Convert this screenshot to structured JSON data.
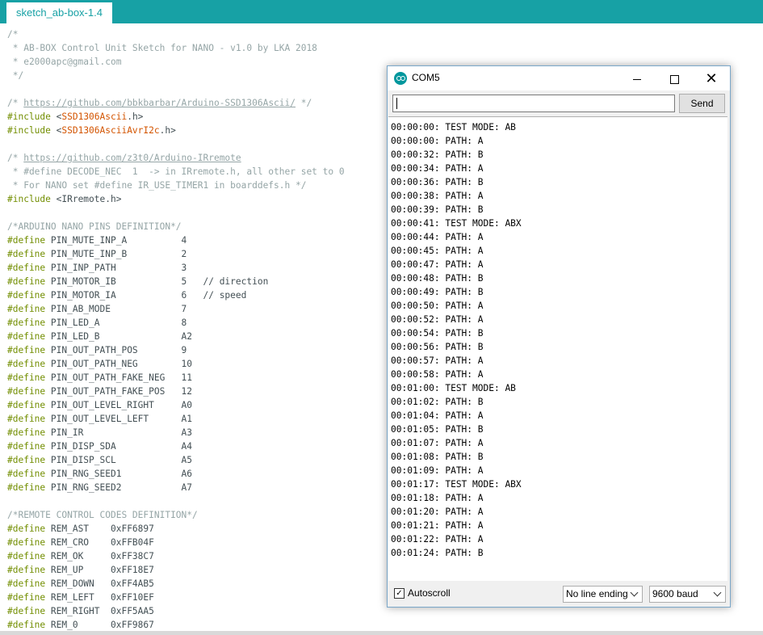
{
  "editor": {
    "tab_label": "sketch_ab-box-1.4",
    "lines": [
      [
        [
          "com",
          "/*"
        ]
      ],
      [
        [
          "com",
          " * AB-BOX Control Unit Sketch for NANO - v1.0 by LKA 2018"
        ]
      ],
      [
        [
          "com",
          " * e2000apc@gmail.com"
        ]
      ],
      [
        [
          "com",
          " */"
        ]
      ],
      [],
      [
        [
          "com",
          "/* "
        ],
        [
          "link",
          "https://github.com/bbkbarbar/Arduino-SSD1306Ascii/"
        ],
        [
          "com",
          " */"
        ]
      ],
      [
        [
          "kw",
          "#include"
        ],
        [
          "plain",
          " <"
        ],
        [
          "lib",
          "SSD1306Ascii"
        ],
        [
          "plain",
          ".h>"
        ]
      ],
      [
        [
          "kw",
          "#include"
        ],
        [
          "plain",
          " <"
        ],
        [
          "lib",
          "SSD1306AsciiAvrI2c"
        ],
        [
          "plain",
          ".h>"
        ]
      ],
      [],
      [
        [
          "com",
          "/* "
        ],
        [
          "link",
          "https://github.com/z3t0/Arduino-IRremote"
        ]
      ],
      [
        [
          "com",
          " * #define DECODE_NEC  1  -> in IRremote.h, all other set to 0"
        ]
      ],
      [
        [
          "com",
          " * For NANO set #define IR_USE_TIMER1 in boarddefs.h */"
        ]
      ],
      [
        [
          "kw",
          "#include"
        ],
        [
          "plain",
          " <IRremote.h>"
        ]
      ],
      [],
      [
        [
          "com",
          "/*ARDUINO NANO PINS DEFINITION*/"
        ]
      ],
      [
        [
          "kw",
          "#define"
        ],
        [
          "plain",
          " PIN_MUTE_INP_A          4"
        ]
      ],
      [
        [
          "kw",
          "#define"
        ],
        [
          "plain",
          " PIN_MUTE_INP_B          2"
        ]
      ],
      [
        [
          "kw",
          "#define"
        ],
        [
          "plain",
          " PIN_INP_PATH            3"
        ]
      ],
      [
        [
          "kw",
          "#define"
        ],
        [
          "plain",
          " PIN_MOTOR_IB            5   // direction"
        ]
      ],
      [
        [
          "kw",
          "#define"
        ],
        [
          "plain",
          " PIN_MOTOR_IA            6   // speed"
        ]
      ],
      [
        [
          "kw",
          "#define"
        ],
        [
          "plain",
          " PIN_AB_MODE             7"
        ]
      ],
      [
        [
          "kw",
          "#define"
        ],
        [
          "plain",
          " PIN_LED_A               8"
        ]
      ],
      [
        [
          "kw",
          "#define"
        ],
        [
          "plain",
          " PIN_LED_B               A2"
        ]
      ],
      [
        [
          "kw",
          "#define"
        ],
        [
          "plain",
          " PIN_OUT_PATH_POS        9"
        ]
      ],
      [
        [
          "kw",
          "#define"
        ],
        [
          "plain",
          " PIN_OUT_PATH_NEG        10"
        ]
      ],
      [
        [
          "kw",
          "#define"
        ],
        [
          "plain",
          " PIN_OUT_PATH_FAKE_NEG   11"
        ]
      ],
      [
        [
          "kw",
          "#define"
        ],
        [
          "plain",
          " PIN_OUT_PATH_FAKE_POS   12"
        ]
      ],
      [
        [
          "kw",
          "#define"
        ],
        [
          "plain",
          " PIN_OUT_LEVEL_RIGHT     A0"
        ]
      ],
      [
        [
          "kw",
          "#define"
        ],
        [
          "plain",
          " PIN_OUT_LEVEL_LEFT      A1"
        ]
      ],
      [
        [
          "kw",
          "#define"
        ],
        [
          "plain",
          " PIN_IR                  A3"
        ]
      ],
      [
        [
          "kw",
          "#define"
        ],
        [
          "plain",
          " PIN_DISP_SDA            A4"
        ]
      ],
      [
        [
          "kw",
          "#define"
        ],
        [
          "plain",
          " PIN_DISP_SCL            A5"
        ]
      ],
      [
        [
          "kw",
          "#define"
        ],
        [
          "plain",
          " PIN_RNG_SEED1           A6"
        ]
      ],
      [
        [
          "kw",
          "#define"
        ],
        [
          "plain",
          " PIN_RNG_SEED2           A7"
        ]
      ],
      [],
      [
        [
          "com",
          "/*REMOTE CONTROL CODES DEFINITION*/"
        ]
      ],
      [
        [
          "kw",
          "#define"
        ],
        [
          "plain",
          " REM_AST    0xFF6897"
        ]
      ],
      [
        [
          "kw",
          "#define"
        ],
        [
          "plain",
          " REM_CRO    0xFFB04F"
        ]
      ],
      [
        [
          "kw",
          "#define"
        ],
        [
          "plain",
          " REM_OK     0xFF38C7"
        ]
      ],
      [
        [
          "kw",
          "#define"
        ],
        [
          "plain",
          " REM_UP     0xFF18E7"
        ]
      ],
      [
        [
          "kw",
          "#define"
        ],
        [
          "plain",
          " REM_DOWN   0xFF4AB5"
        ]
      ],
      [
        [
          "kw",
          "#define"
        ],
        [
          "plain",
          " REM_LEFT   0xFF10EF"
        ]
      ],
      [
        [
          "kw",
          "#define"
        ],
        [
          "plain",
          " REM_RIGHT  0xFF5AA5"
        ]
      ],
      [
        [
          "kw",
          "#define"
        ],
        [
          "plain",
          " REM_0      0xFF9867"
        ]
      ]
    ]
  },
  "serial_monitor": {
    "title": "COM5",
    "app_icon": "arduino-icon",
    "input_value": "",
    "send_label": "Send",
    "output_lines": [
      "00:00:00: TEST MODE: AB",
      "00:00:00: PATH: A",
      "00:00:32: PATH: B",
      "00:00:34: PATH: A",
      "00:00:36: PATH: B",
      "00:00:38: PATH: A",
      "00:00:39: PATH: B",
      "00:00:41: TEST MODE: ABX",
      "00:00:44: PATH: A",
      "00:00:45: PATH: A",
      "00:00:47: PATH: A",
      "00:00:48: PATH: B",
      "00:00:49: PATH: B",
      "00:00:50: PATH: A",
      "00:00:52: PATH: A",
      "00:00:54: PATH: B",
      "00:00:56: PATH: B",
      "00:00:57: PATH: A",
      "00:00:58: PATH: A",
      "00:01:00: TEST MODE: AB",
      "00:01:02: PATH: B",
      "00:01:04: PATH: A",
      "00:01:05: PATH: B",
      "00:01:07: PATH: A",
      "00:01:08: PATH: B",
      "00:01:09: PATH: A",
      "00:01:17: TEST MODE: ABX",
      "00:01:18: PATH: A",
      "00:01:20: PATH: A",
      "00:01:21: PATH: A",
      "00:01:22: PATH: A",
      "00:01:24: PATH: B"
    ],
    "autoscroll_label": "Autoscroll",
    "autoscroll_checked": true,
    "line_ending": "No line ending",
    "baud": "9600 baud"
  }
}
